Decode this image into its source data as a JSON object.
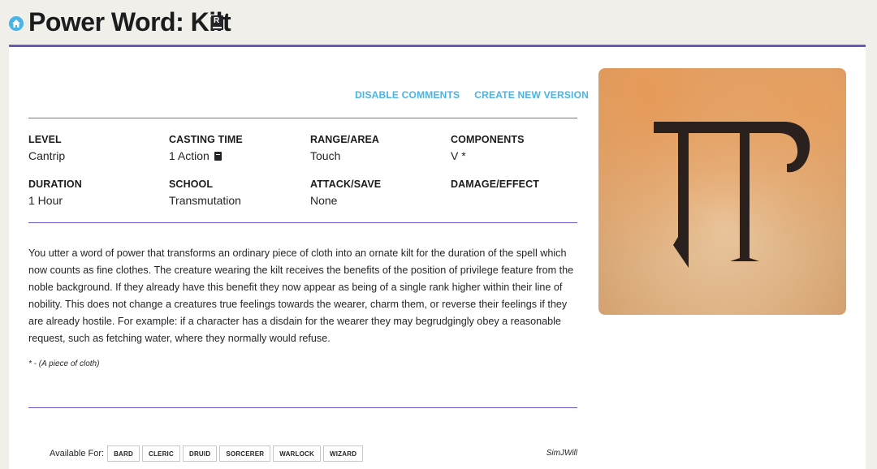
{
  "header": {
    "title": "Power Word: Kilt",
    "source_badge": "R"
  },
  "actions": {
    "disable_comments": "DISABLE COMMENTS",
    "create_new_version": "CREATE NEW VERSION"
  },
  "stats": [
    {
      "label": "LEVEL",
      "value": "Cantrip"
    },
    {
      "label": "CASTING TIME",
      "value": "1 Action"
    },
    {
      "label": "RANGE/AREA",
      "value": "Touch"
    },
    {
      "label": "COMPONENTS",
      "value": "V *"
    },
    {
      "label": "DURATION",
      "value": "1 Hour"
    },
    {
      "label": "SCHOOL",
      "value": "Transmutation"
    },
    {
      "label": "ATTACK/SAVE",
      "value": "None"
    },
    {
      "label": "DAMAGE/EFFECT",
      "value": ""
    }
  ],
  "description": "You utter a word of power that transforms an ordinary piece of cloth into an ornate kilt for the duration of the spell which now counts as fine clothes. The creature wearing the kilt receives the benefits of the position of privilege feature from the noble background. If they already have this benefit they now appear as being of a single rank higher within their line of nobility. This does not change a creatures true feelings towards the wearer, charm them, or reverse their feelings if they are already hostile. For example: if a character has a disdain for the wearer they may begrudgingly obey a reasonable request, such as fetching water, where they normally would refuse.",
  "footnote": "* - (A piece of cloth)",
  "available_for": {
    "label": "Available For:",
    "classes": [
      "BARD",
      "CLERIC",
      "DRUID",
      "SORCERER",
      "WARLOCK",
      "WIZARD"
    ]
  },
  "author": "SimJWill",
  "colors": {
    "accent_blue": "#47b5e5",
    "rule_purple": "#6a56c4",
    "rule_blue": "#4b7bd4"
  },
  "icons": {
    "home": "home-icon",
    "source": "rulebook-icon",
    "casting_time": "book-icon"
  }
}
